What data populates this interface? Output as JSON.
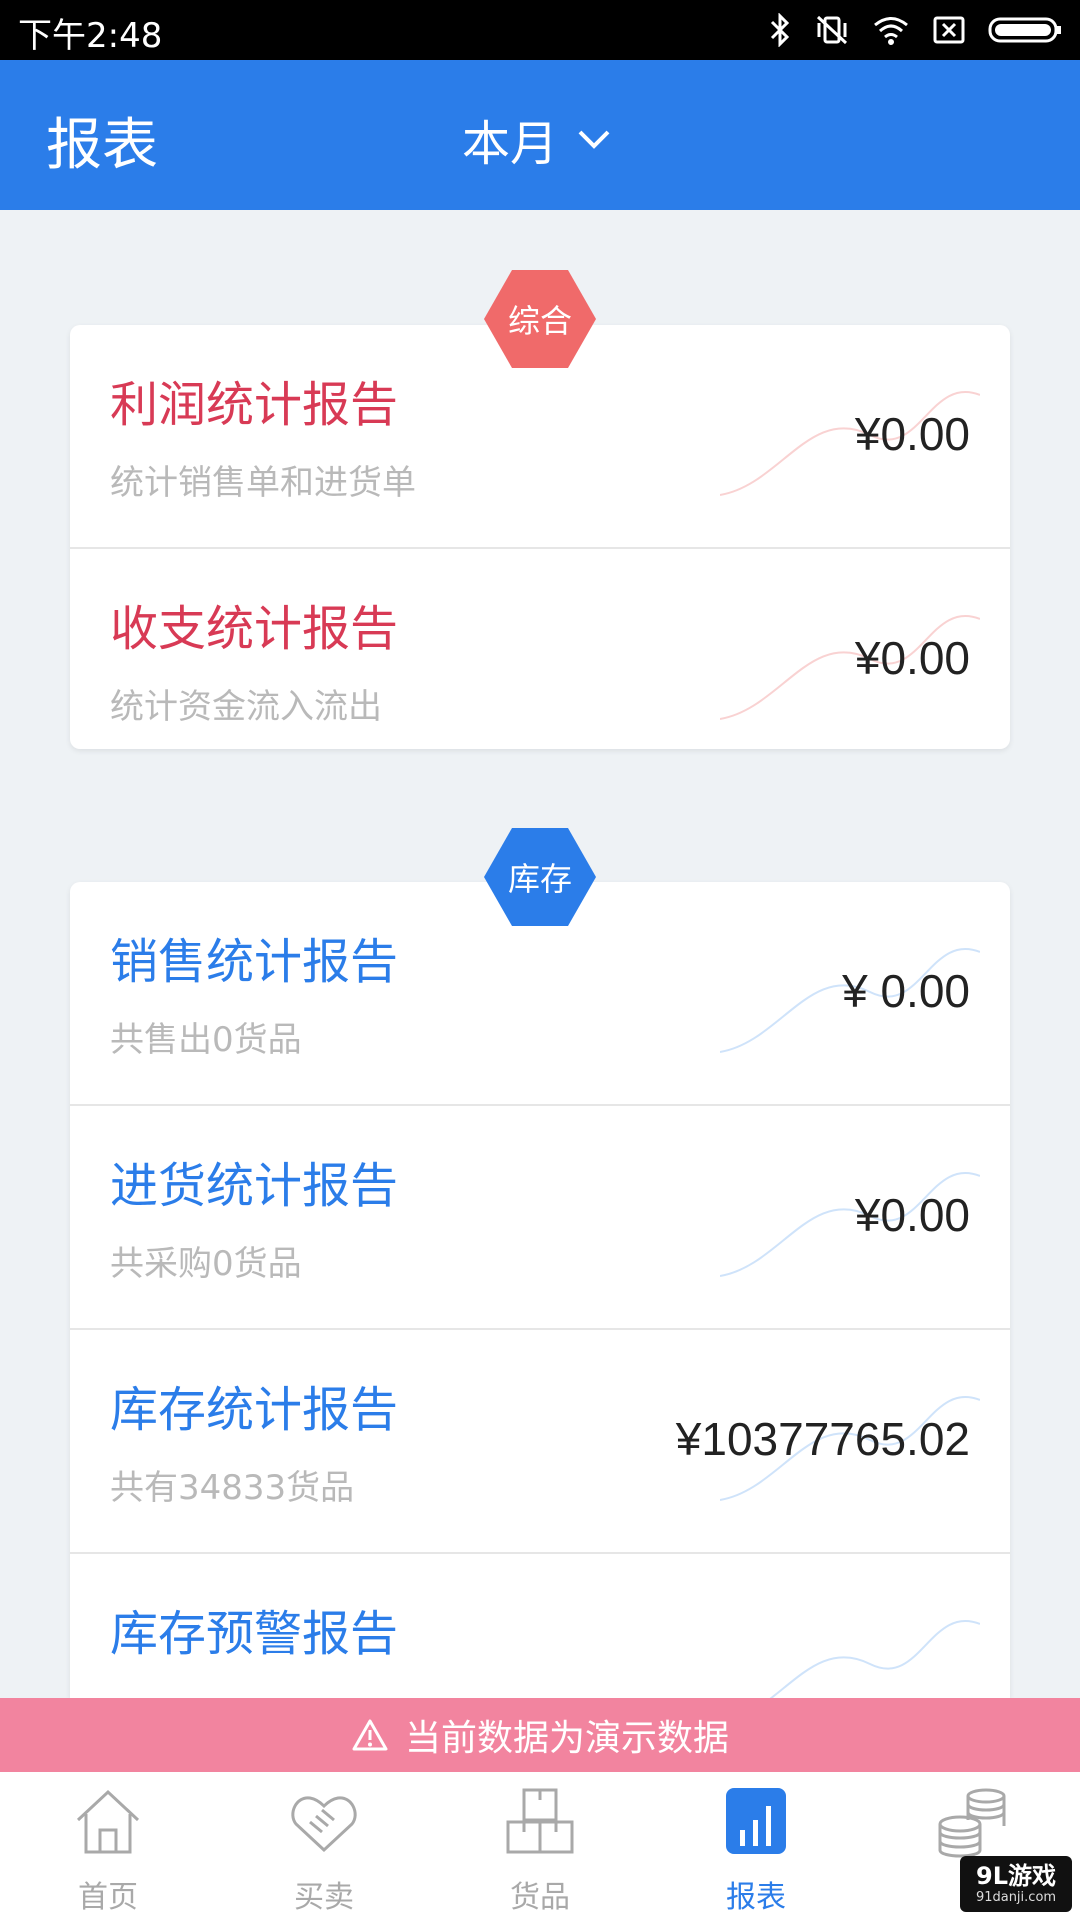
{
  "status_bar": {
    "time": "下午2:48"
  },
  "app_bar": {
    "title": "报表",
    "period": "本月"
  },
  "sections": [
    {
      "badge": "综合",
      "badge_color": "#f06a6a",
      "rows": [
        {
          "title": "利润统计报告",
          "subtitle": "统计销售单和进货单",
          "amount": "¥0.00"
        },
        {
          "title": "收支统计报告",
          "subtitle": "统计资金流入流出",
          "amount": "¥0.00"
        }
      ]
    },
    {
      "badge": "库存",
      "badge_color": "#2b7de9",
      "rows": [
        {
          "title": "销售统计报告",
          "subtitle": "共售出0货品",
          "amount": "¥ 0.00"
        },
        {
          "title": "进货统计报告",
          "subtitle": "共采购0货品",
          "amount": "¥0.00"
        },
        {
          "title": "库存统计报告",
          "subtitle": "共有34833货品",
          "amount": "¥10377765.02"
        },
        {
          "title": "库存预警报告",
          "subtitle": "",
          "amount": ""
        }
      ]
    }
  ],
  "demo_notice": "当前数据为演示数据",
  "bottom_nav": [
    {
      "label": "首页",
      "icon": "home-icon",
      "active": false
    },
    {
      "label": "买卖",
      "icon": "handshake-icon",
      "active": false
    },
    {
      "label": "货品",
      "icon": "boxes-icon",
      "active": false
    },
    {
      "label": "报表",
      "icon": "bar-chart-icon",
      "active": true
    },
    {
      "label": "",
      "icon": "coins-icon",
      "active": false
    }
  ],
  "watermark": {
    "main": "9L游戏",
    "sub": "91danji.com"
  },
  "colors": {
    "primary": "#2b7de9",
    "red_title": "#d83a55",
    "demo_bar": "#f2849f"
  }
}
